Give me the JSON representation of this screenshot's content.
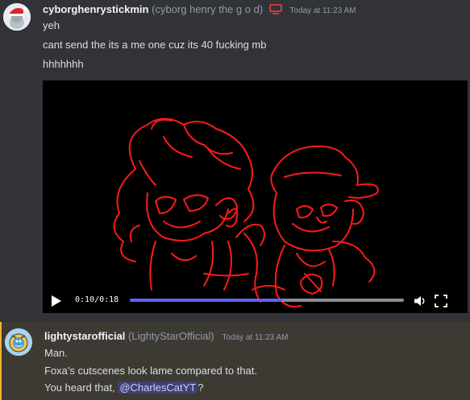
{
  "messages": [
    {
      "username": "cyborghenrystickmin",
      "nickname": "(cyborg henry the g o d)",
      "timestamp": "Today at 11:23 AM",
      "avatar_icon": "santa-hat-avatar-icon",
      "lines": [
        "yeh",
        "cant send the its a me one cuz its 40 fucking mb",
        "hhhhhhh"
      ],
      "video": {
        "current_time": "0:10",
        "separator": "/",
        "duration": "0:18",
        "progress_fraction": 0.556,
        "art_color": "#ff1a1a"
      }
    },
    {
      "username": "lightystarofficial",
      "nickname": "(LightyStarOfficial)",
      "timestamp": "Today at 11:23 AM",
      "avatar_icon": "cartoon-character-avatar-icon",
      "lines": [
        "Man.",
        "Foxa's cutscenes look lame compared to that."
      ],
      "line3_prefix": "You heard that,",
      "mention": "@CharlesCatYT",
      "line3_suffix": "?",
      "highlight_color": "#f0b232"
    }
  ],
  "colors": {
    "background": "#313338",
    "mention_bg": "#3d4270",
    "accent": "#5865f2",
    "monitor_icon": "#f23f43"
  }
}
